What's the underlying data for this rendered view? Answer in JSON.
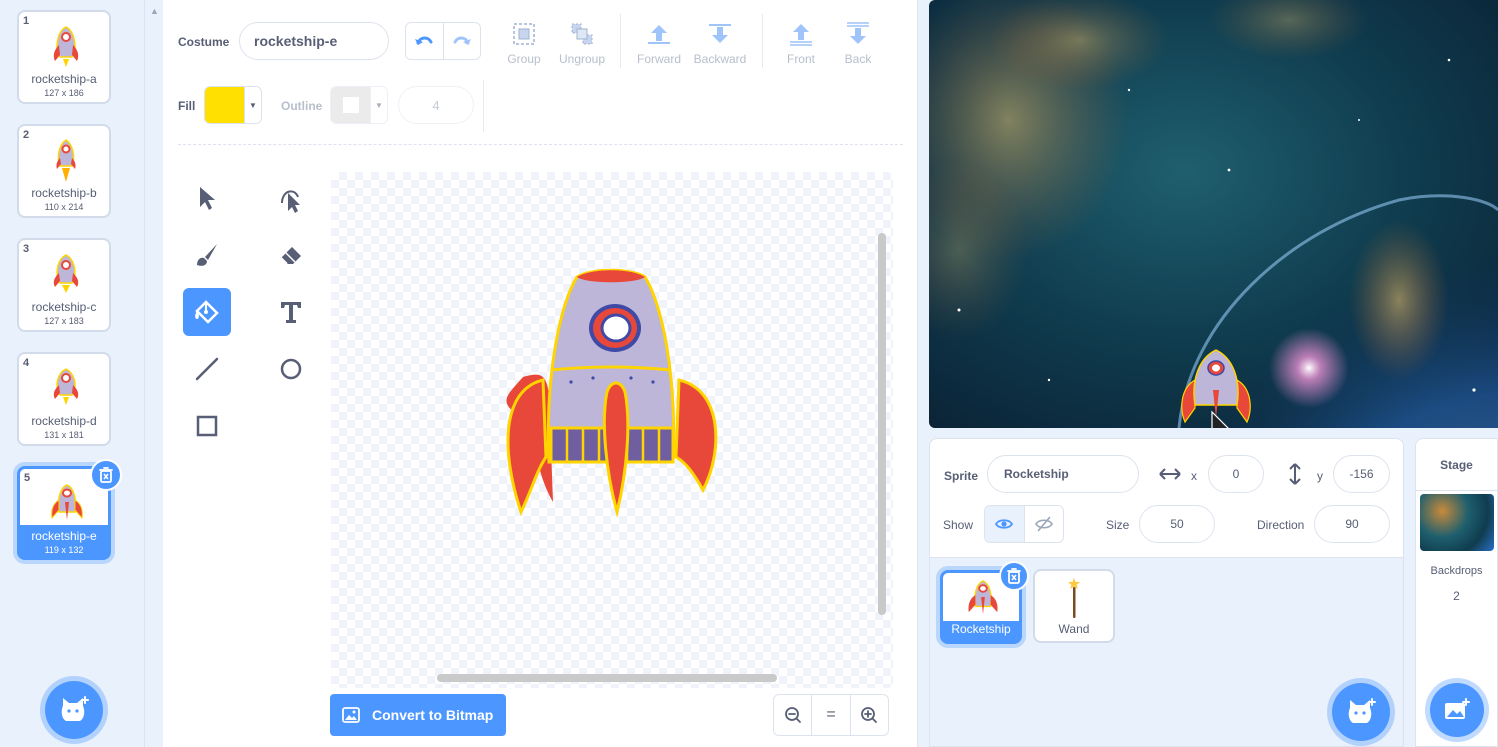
{
  "costumes": [
    {
      "number": "1",
      "name": "rocketship-a",
      "size": "127 x 186"
    },
    {
      "number": "2",
      "name": "rocketship-b",
      "size": "110 x 214"
    },
    {
      "number": "3",
      "name": "rocketship-c",
      "size": "127 x 183"
    },
    {
      "number": "4",
      "name": "rocketship-d",
      "size": "131 x 181"
    },
    {
      "number": "5",
      "name": "rocketship-e",
      "size": "119 x 132"
    }
  ],
  "editor": {
    "costume_label": "Costume",
    "costume_name": "rocketship-e",
    "group_label": "Group",
    "ungroup_label": "Ungroup",
    "forward_label": "Forward",
    "backward_label": "Backward",
    "front_label": "Front",
    "back_label": "Back",
    "fill_label": "Fill",
    "fill_color": "#ffe000",
    "outline_label": "Outline",
    "outline_width": "4",
    "convert_label": "Convert to Bitmap",
    "zoom_reset": "="
  },
  "sprite_info": {
    "sprite_label": "Sprite",
    "sprite_name": "Rocketship",
    "x_label": "x",
    "x_value": "0",
    "y_label": "y",
    "y_value": "-156",
    "show_label": "Show",
    "size_label": "Size",
    "size_value": "50",
    "direction_label": "Direction",
    "direction_value": "90"
  },
  "sprites": [
    {
      "name": "Rocketship"
    },
    {
      "name": "Wand"
    }
  ],
  "stage_pane": {
    "title": "Stage",
    "backdrops_label": "Backdrops",
    "backdrops_count": "2"
  },
  "colors": {
    "accent": "#4c97ff",
    "text": "#575e75",
    "rocket_body": "#bdb6d9",
    "rocket_red": "#e8483a"
  }
}
